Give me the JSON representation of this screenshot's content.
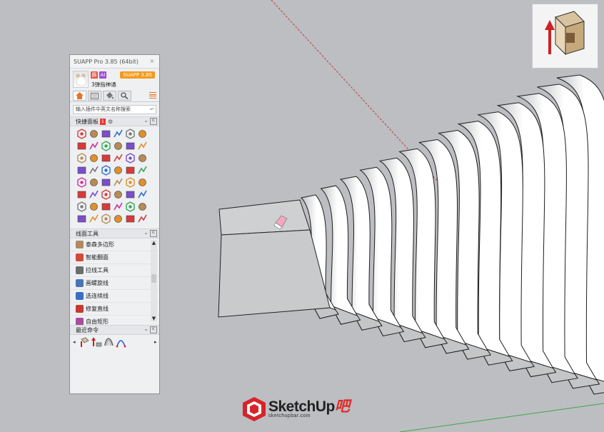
{
  "panel": {
    "title": "SUAPP Pro 3.85 (64bit)",
    "close": "×",
    "user": {
      "name": "3弹指神通",
      "vip_badge": "豚",
      "ai_badge": "AI",
      "version_button": "SUAPP 3.85"
    },
    "search": {
      "placeholder": "输入插件中英文名称搜索",
      "enter_icon": "↵"
    },
    "quick_panel": {
      "label": "快捷面板",
      "badge": "1",
      "gear": "⚙",
      "chevron": "⌄",
      "pop": "⇱"
    },
    "line_tools": {
      "label": "线面工具",
      "chevron": "⌄",
      "pop": "⇱",
      "items": [
        {
          "label": "泰森多边形",
          "color": "#b28a62"
        },
        {
          "label": "智能翻面",
          "color": "#d24a3a"
        },
        {
          "label": "拉线工具",
          "color": "#6d6d6d"
        },
        {
          "label": "画螺旋线",
          "color": "#4a74b8"
        },
        {
          "label": "选连续线",
          "color": "#3b6fc4"
        },
        {
          "label": "修复直线",
          "color": "#c63b2f"
        },
        {
          "label": "自由矩形",
          "color": "#a84d9c"
        }
      ],
      "scroll_up": "▲",
      "scroll_down": "▼"
    },
    "recent": {
      "label": "最近命令",
      "chevron": "⌄",
      "pop": "⇱",
      "prev": "◂",
      "next": "▸"
    }
  },
  "colors": {
    "background": "#bcbec2",
    "accent_orange": "#f59a1b",
    "badge_red": "#e53935"
  },
  "watermark": {
    "brand_main": "SketchUp",
    "brand_suffix": "吧",
    "url": "sketchupbar.com"
  },
  "view_icon": "front-view-icon"
}
